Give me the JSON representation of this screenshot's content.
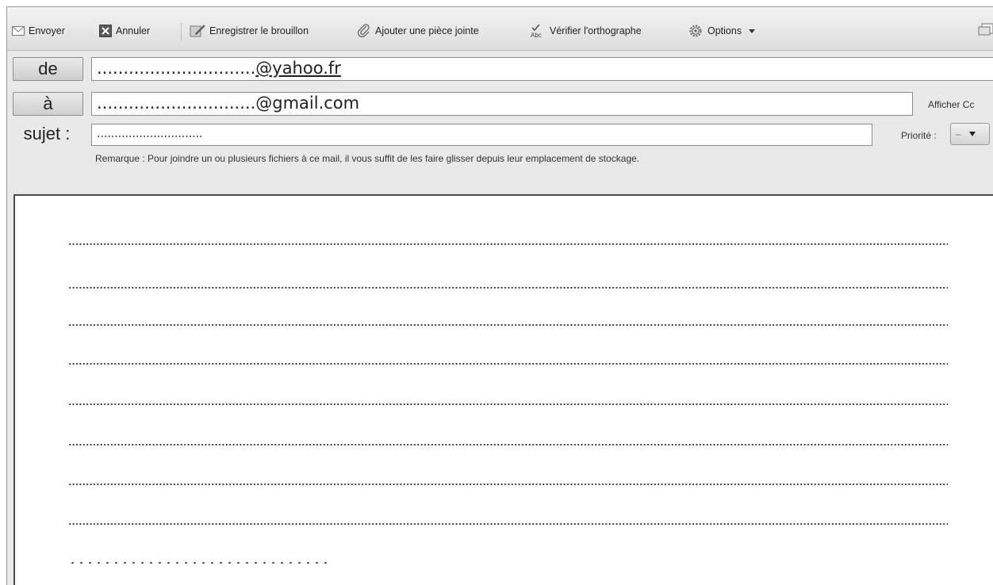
{
  "toolbar": {
    "send_label": "Envoyer",
    "send_icon": "envelope-icon",
    "cancel_label": "Annuler",
    "cancel_icon": "close-box-icon",
    "draft_label": "Enregistrer le brouillon",
    "draft_icon": "save-draft-icon",
    "attach_label": "Ajouter une pièce jointe",
    "attach_icon": "paperclip-icon",
    "spell_label": "Vérifier l'orthographe",
    "spell_icon": "spellcheck-icon",
    "options_label": "Options",
    "options_icon": "gear-icon"
  },
  "header": {
    "from_label": "de",
    "from_prefix": "..............................",
    "from_domain": "@yahoo.fr",
    "to_label": "à",
    "to_value": "..............................@gmail.com",
    "cc_link": "Afficher Cc",
    "subject_label": "sujet :",
    "subject_value": "..............................",
    "priority_label": "Priorité :",
    "priority_value": "–",
    "remark": "Remarque : Pour joindre un ou plusieurs fichiers à ce mail, il vous suffit de les faire glisser depuis leur emplacement de stockage."
  },
  "body": {
    "lines": [
      "..................................................................................................................................",
      "..................................................................................................................................",
      "..................................................................................................................................",
      "..................................................................................................................................",
      "..................................................................................................................................",
      "..................................................................................................................................",
      "..................................................................................................................................",
      "..................................................................................................................................",
      "…………………………………"
    ]
  },
  "colors": {
    "toolbar_bg": "#e6e6e6",
    "field_border": "#8e8e8e",
    "body_border": "#4a4a4a"
  }
}
